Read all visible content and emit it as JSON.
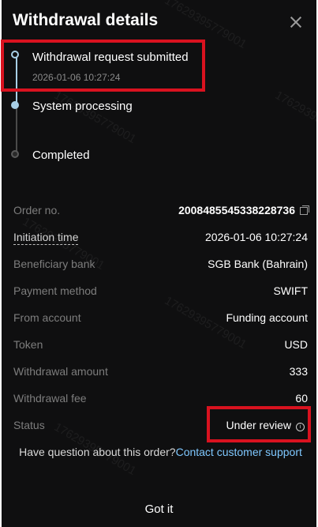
{
  "modal": {
    "title": "Withdrawal details"
  },
  "timeline": {
    "steps": [
      {
        "label": "Withdrawal request submitted",
        "time": "2026-01-06 10:27:24"
      },
      {
        "label": "System processing"
      },
      {
        "label": "Completed"
      }
    ]
  },
  "details": [
    {
      "label": "Order no.",
      "value": "2008485545338228736"
    },
    {
      "label": "Initiation time",
      "value": "2026-01-06 10:27:24"
    },
    {
      "label": "Beneficiary bank",
      "value": "SGB Bank (Bahrain)"
    },
    {
      "label": "Payment method",
      "value": "SWIFT"
    },
    {
      "label": "From account",
      "value": "Funding account"
    },
    {
      "label": "Token",
      "value": "USD"
    },
    {
      "label": "Withdrawal amount",
      "value": "333"
    },
    {
      "label": "Withdrawal fee",
      "value": "60"
    },
    {
      "label": "Status",
      "value": "Under review"
    }
  ],
  "support": {
    "question": "Have question about this order?",
    "link": "Contact customer support"
  },
  "footer": {
    "button": "Got it"
  },
  "watermark": "17629395779001",
  "colors": {
    "background": "#0f0f10",
    "accent": "#a8cfe6",
    "link": "#7fc8ff",
    "highlight": "#d9121f"
  }
}
